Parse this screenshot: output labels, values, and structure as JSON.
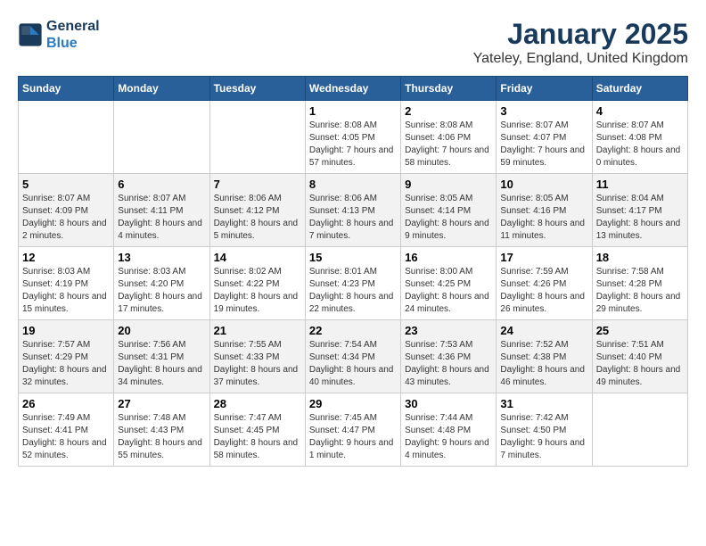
{
  "header": {
    "logo_line1": "General",
    "logo_line2": "Blue",
    "title": "January 2025",
    "subtitle": "Yateley, England, United Kingdom"
  },
  "days_of_week": [
    "Sunday",
    "Monday",
    "Tuesday",
    "Wednesday",
    "Thursday",
    "Friday",
    "Saturday"
  ],
  "weeks": [
    [
      {
        "day": "",
        "info": ""
      },
      {
        "day": "",
        "info": ""
      },
      {
        "day": "",
        "info": ""
      },
      {
        "day": "1",
        "info": "Sunrise: 8:08 AM\nSunset: 4:05 PM\nDaylight: 7 hours and 57 minutes."
      },
      {
        "day": "2",
        "info": "Sunrise: 8:08 AM\nSunset: 4:06 PM\nDaylight: 7 hours and 58 minutes."
      },
      {
        "day": "3",
        "info": "Sunrise: 8:07 AM\nSunset: 4:07 PM\nDaylight: 7 hours and 59 minutes."
      },
      {
        "day": "4",
        "info": "Sunrise: 8:07 AM\nSunset: 4:08 PM\nDaylight: 8 hours and 0 minutes."
      }
    ],
    [
      {
        "day": "5",
        "info": "Sunrise: 8:07 AM\nSunset: 4:09 PM\nDaylight: 8 hours and 2 minutes."
      },
      {
        "day": "6",
        "info": "Sunrise: 8:07 AM\nSunset: 4:11 PM\nDaylight: 8 hours and 4 minutes."
      },
      {
        "day": "7",
        "info": "Sunrise: 8:06 AM\nSunset: 4:12 PM\nDaylight: 8 hours and 5 minutes."
      },
      {
        "day": "8",
        "info": "Sunrise: 8:06 AM\nSunset: 4:13 PM\nDaylight: 8 hours and 7 minutes."
      },
      {
        "day": "9",
        "info": "Sunrise: 8:05 AM\nSunset: 4:14 PM\nDaylight: 8 hours and 9 minutes."
      },
      {
        "day": "10",
        "info": "Sunrise: 8:05 AM\nSunset: 4:16 PM\nDaylight: 8 hours and 11 minutes."
      },
      {
        "day": "11",
        "info": "Sunrise: 8:04 AM\nSunset: 4:17 PM\nDaylight: 8 hours and 13 minutes."
      }
    ],
    [
      {
        "day": "12",
        "info": "Sunrise: 8:03 AM\nSunset: 4:19 PM\nDaylight: 8 hours and 15 minutes."
      },
      {
        "day": "13",
        "info": "Sunrise: 8:03 AM\nSunset: 4:20 PM\nDaylight: 8 hours and 17 minutes."
      },
      {
        "day": "14",
        "info": "Sunrise: 8:02 AM\nSunset: 4:22 PM\nDaylight: 8 hours and 19 minutes."
      },
      {
        "day": "15",
        "info": "Sunrise: 8:01 AM\nSunset: 4:23 PM\nDaylight: 8 hours and 22 minutes."
      },
      {
        "day": "16",
        "info": "Sunrise: 8:00 AM\nSunset: 4:25 PM\nDaylight: 8 hours and 24 minutes."
      },
      {
        "day": "17",
        "info": "Sunrise: 7:59 AM\nSunset: 4:26 PM\nDaylight: 8 hours and 26 minutes."
      },
      {
        "day": "18",
        "info": "Sunrise: 7:58 AM\nSunset: 4:28 PM\nDaylight: 8 hours and 29 minutes."
      }
    ],
    [
      {
        "day": "19",
        "info": "Sunrise: 7:57 AM\nSunset: 4:29 PM\nDaylight: 8 hours and 32 minutes."
      },
      {
        "day": "20",
        "info": "Sunrise: 7:56 AM\nSunset: 4:31 PM\nDaylight: 8 hours and 34 minutes."
      },
      {
        "day": "21",
        "info": "Sunrise: 7:55 AM\nSunset: 4:33 PM\nDaylight: 8 hours and 37 minutes."
      },
      {
        "day": "22",
        "info": "Sunrise: 7:54 AM\nSunset: 4:34 PM\nDaylight: 8 hours and 40 minutes."
      },
      {
        "day": "23",
        "info": "Sunrise: 7:53 AM\nSunset: 4:36 PM\nDaylight: 8 hours and 43 minutes."
      },
      {
        "day": "24",
        "info": "Sunrise: 7:52 AM\nSunset: 4:38 PM\nDaylight: 8 hours and 46 minutes."
      },
      {
        "day": "25",
        "info": "Sunrise: 7:51 AM\nSunset: 4:40 PM\nDaylight: 8 hours and 49 minutes."
      }
    ],
    [
      {
        "day": "26",
        "info": "Sunrise: 7:49 AM\nSunset: 4:41 PM\nDaylight: 8 hours and 52 minutes."
      },
      {
        "day": "27",
        "info": "Sunrise: 7:48 AM\nSunset: 4:43 PM\nDaylight: 8 hours and 55 minutes."
      },
      {
        "day": "28",
        "info": "Sunrise: 7:47 AM\nSunset: 4:45 PM\nDaylight: 8 hours and 58 minutes."
      },
      {
        "day": "29",
        "info": "Sunrise: 7:45 AM\nSunset: 4:47 PM\nDaylight: 9 hours and 1 minute."
      },
      {
        "day": "30",
        "info": "Sunrise: 7:44 AM\nSunset: 4:48 PM\nDaylight: 9 hours and 4 minutes."
      },
      {
        "day": "31",
        "info": "Sunrise: 7:42 AM\nSunset: 4:50 PM\nDaylight: 9 hours and 7 minutes."
      },
      {
        "day": "",
        "info": ""
      }
    ]
  ]
}
